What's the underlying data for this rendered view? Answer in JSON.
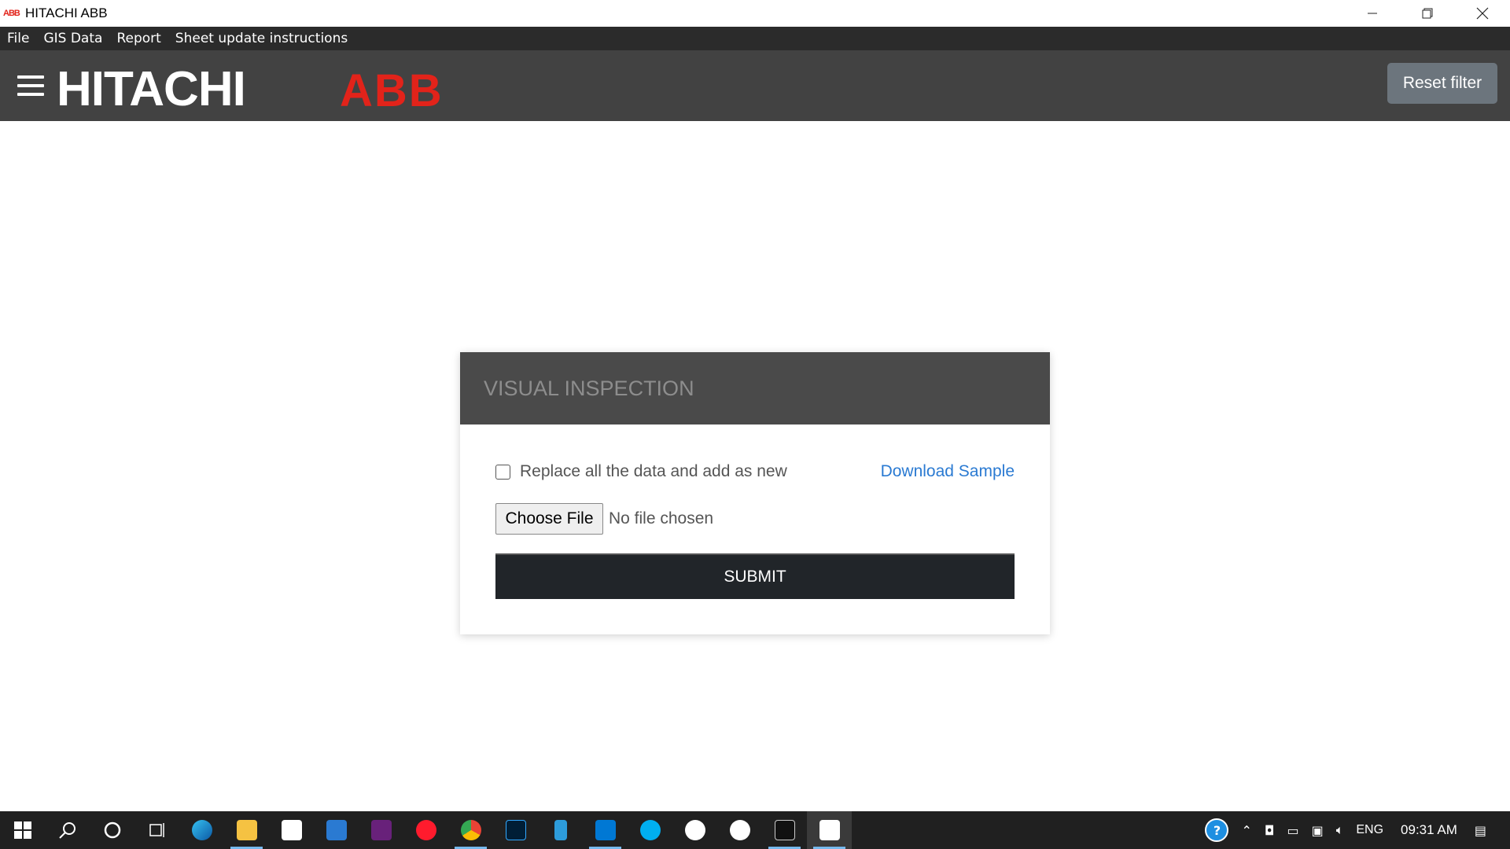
{
  "window": {
    "title": "HITACHI ABB",
    "app_icon_text": "ABB",
    "minimize_icon": "minimize-icon",
    "restore_icon": "restore-icon",
    "close_icon": "close-icon"
  },
  "menu": {
    "items": [
      "File",
      "GIS Data",
      "Report",
      "Sheet update instructions"
    ]
  },
  "header": {
    "logo_hitachi": "HITACHI",
    "logo_abb": "ABB",
    "reset_label": "Reset filter",
    "accent_color": "#e2231a",
    "bg_color": "#424242"
  },
  "card": {
    "title": "VISUAL INSPECTION",
    "checkbox_label": "Replace all the data and add as new",
    "checkbox_checked": false,
    "download_label": "Download Sample",
    "file_button_label": "Choose File",
    "file_status": "No file chosen",
    "submit_label": "SUBMIT"
  },
  "taskbar": {
    "apps": [
      {
        "name": "start-icon"
      },
      {
        "name": "search-icon"
      },
      {
        "name": "cortana-icon"
      },
      {
        "name": "task-view-icon"
      },
      {
        "name": "edge-icon"
      },
      {
        "name": "file-explorer-icon"
      },
      {
        "name": "store-icon"
      },
      {
        "name": "mail-icon"
      },
      {
        "name": "visual-studio-icon"
      },
      {
        "name": "opera-icon"
      },
      {
        "name": "chrome-icon"
      },
      {
        "name": "photoshop-icon"
      },
      {
        "name": "notes-icon"
      },
      {
        "name": "vscode-icon"
      },
      {
        "name": "skype-icon"
      },
      {
        "name": "mongodb-icon"
      },
      {
        "name": "app-icon"
      },
      {
        "name": "terminal-icon"
      },
      {
        "name": "hitachi-abb-app-icon"
      }
    ],
    "tray": {
      "language": "ENG",
      "time": "09:31 AM"
    }
  }
}
